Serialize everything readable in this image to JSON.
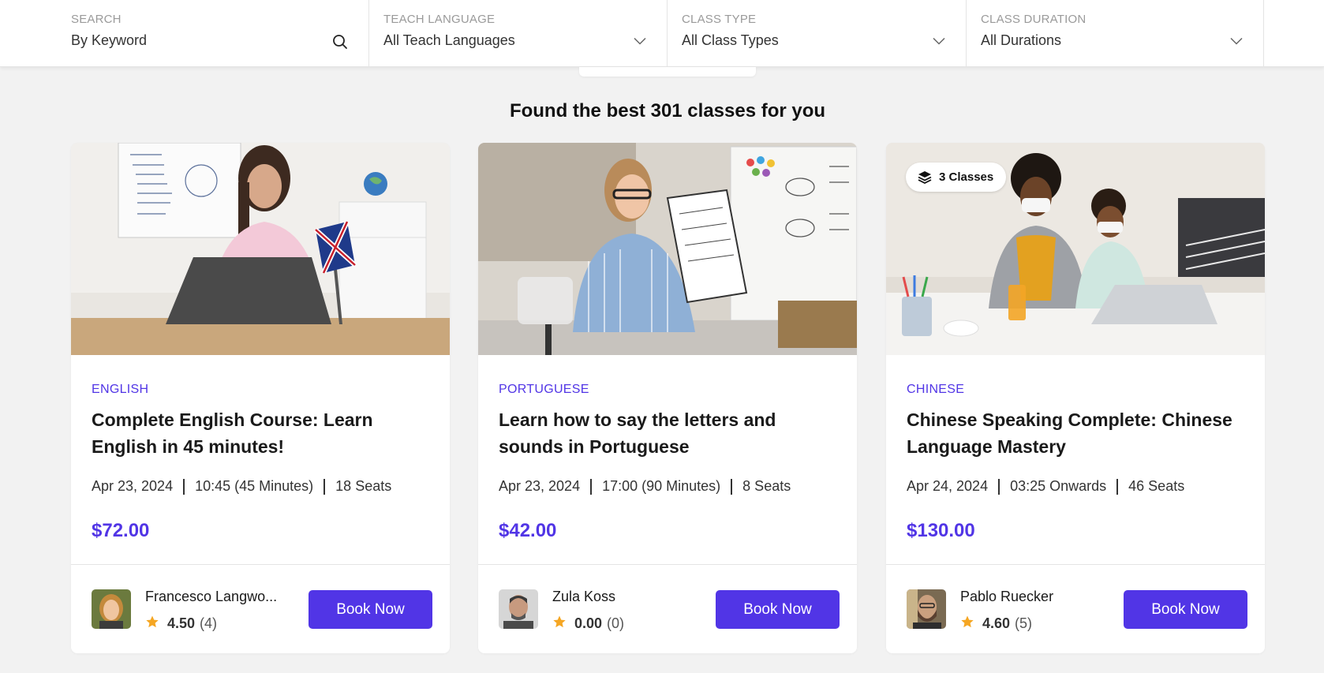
{
  "filters": {
    "search": {
      "label": "SEARCH",
      "value": "By Keyword"
    },
    "teach_language": {
      "label": "TEACH LANGUAGE",
      "value": "All Teach Languages"
    },
    "class_type": {
      "label": "CLASS TYPE",
      "value": "All Class Types"
    },
    "class_duration": {
      "label": "CLASS DURATION",
      "value": "All Durations"
    }
  },
  "results_heading": "Found the best 301 classes for you",
  "colors": {
    "accent": "#5135e6",
    "star": "#f5a623",
    "background": "#f2f2f2"
  },
  "cards": [
    {
      "language": "ENGLISH",
      "title": "Complete English Course: Learn English in 45 minutes!",
      "date": "Apr 23, 2024",
      "time": "10:45 (45 Minutes)",
      "seats": "18 Seats",
      "price": "$72.00",
      "instructor": "Francesco Langwo...",
      "rating": "4.50",
      "reviews": "(4)",
      "button": "Book Now"
    },
    {
      "language": "PORTUGUESE",
      "title": "Learn how to say the letters and sounds in Portuguese",
      "date": "Apr 23, 2024",
      "time": "17:00 (90 Minutes)",
      "seats": "8 Seats",
      "price": "$42.00",
      "instructor": "Zula Koss",
      "rating": "0.00",
      "reviews": "(0)",
      "button": "Book Now"
    },
    {
      "language": "CHINESE",
      "title": "Chinese Speaking Complete: Chinese Language Mastery",
      "date": "Apr 24, 2024",
      "time": "03:25 Onwards",
      "seats": "46 Seats",
      "price": "$130.00",
      "instructor": "Pablo Ruecker",
      "rating": "4.60",
      "reviews": "(5)",
      "button": "Book Now",
      "badge": "3 Classes"
    }
  ]
}
